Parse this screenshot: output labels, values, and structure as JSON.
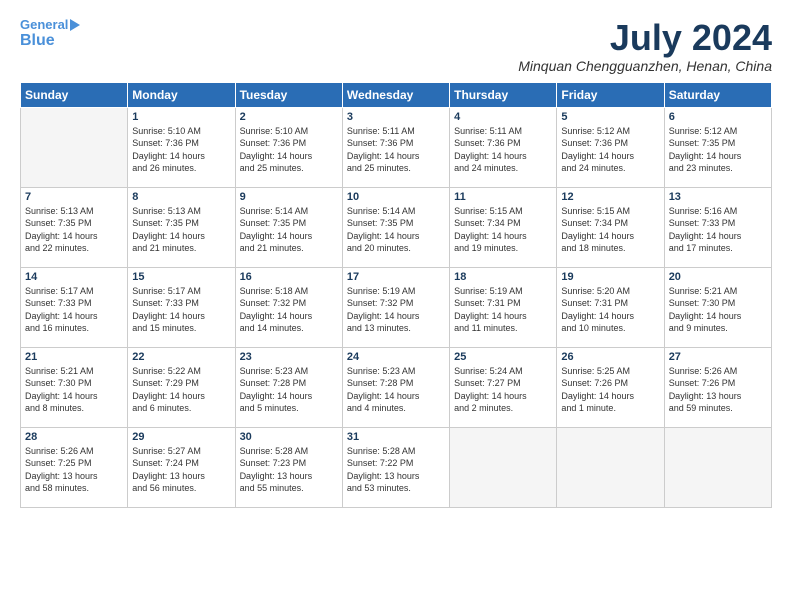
{
  "header": {
    "logo_line1": "General",
    "logo_line2": "Blue",
    "month_title": "July 2024",
    "location": "Minquan Chengguanzhen, Henan, China"
  },
  "weekdays": [
    "Sunday",
    "Monday",
    "Tuesday",
    "Wednesday",
    "Thursday",
    "Friday",
    "Saturday"
  ],
  "weeks": [
    [
      {
        "day": "",
        "info": ""
      },
      {
        "day": "1",
        "info": "Sunrise: 5:10 AM\nSunset: 7:36 PM\nDaylight: 14 hours\nand 26 minutes."
      },
      {
        "day": "2",
        "info": "Sunrise: 5:10 AM\nSunset: 7:36 PM\nDaylight: 14 hours\nand 25 minutes."
      },
      {
        "day": "3",
        "info": "Sunrise: 5:11 AM\nSunset: 7:36 PM\nDaylight: 14 hours\nand 25 minutes."
      },
      {
        "day": "4",
        "info": "Sunrise: 5:11 AM\nSunset: 7:36 PM\nDaylight: 14 hours\nand 24 minutes."
      },
      {
        "day": "5",
        "info": "Sunrise: 5:12 AM\nSunset: 7:36 PM\nDaylight: 14 hours\nand 24 minutes."
      },
      {
        "day": "6",
        "info": "Sunrise: 5:12 AM\nSunset: 7:35 PM\nDaylight: 14 hours\nand 23 minutes."
      }
    ],
    [
      {
        "day": "7",
        "info": "Sunrise: 5:13 AM\nSunset: 7:35 PM\nDaylight: 14 hours\nand 22 minutes."
      },
      {
        "day": "8",
        "info": "Sunrise: 5:13 AM\nSunset: 7:35 PM\nDaylight: 14 hours\nand 21 minutes."
      },
      {
        "day": "9",
        "info": "Sunrise: 5:14 AM\nSunset: 7:35 PM\nDaylight: 14 hours\nand 21 minutes."
      },
      {
        "day": "10",
        "info": "Sunrise: 5:14 AM\nSunset: 7:35 PM\nDaylight: 14 hours\nand 20 minutes."
      },
      {
        "day": "11",
        "info": "Sunrise: 5:15 AM\nSunset: 7:34 PM\nDaylight: 14 hours\nand 19 minutes."
      },
      {
        "day": "12",
        "info": "Sunrise: 5:15 AM\nSunset: 7:34 PM\nDaylight: 14 hours\nand 18 minutes."
      },
      {
        "day": "13",
        "info": "Sunrise: 5:16 AM\nSunset: 7:33 PM\nDaylight: 14 hours\nand 17 minutes."
      }
    ],
    [
      {
        "day": "14",
        "info": "Sunrise: 5:17 AM\nSunset: 7:33 PM\nDaylight: 14 hours\nand 16 minutes."
      },
      {
        "day": "15",
        "info": "Sunrise: 5:17 AM\nSunset: 7:33 PM\nDaylight: 14 hours\nand 15 minutes."
      },
      {
        "day": "16",
        "info": "Sunrise: 5:18 AM\nSunset: 7:32 PM\nDaylight: 14 hours\nand 14 minutes."
      },
      {
        "day": "17",
        "info": "Sunrise: 5:19 AM\nSunset: 7:32 PM\nDaylight: 14 hours\nand 13 minutes."
      },
      {
        "day": "18",
        "info": "Sunrise: 5:19 AM\nSunset: 7:31 PM\nDaylight: 14 hours\nand 11 minutes."
      },
      {
        "day": "19",
        "info": "Sunrise: 5:20 AM\nSunset: 7:31 PM\nDaylight: 14 hours\nand 10 minutes."
      },
      {
        "day": "20",
        "info": "Sunrise: 5:21 AM\nSunset: 7:30 PM\nDaylight: 14 hours\nand 9 minutes."
      }
    ],
    [
      {
        "day": "21",
        "info": "Sunrise: 5:21 AM\nSunset: 7:30 PM\nDaylight: 14 hours\nand 8 minutes."
      },
      {
        "day": "22",
        "info": "Sunrise: 5:22 AM\nSunset: 7:29 PM\nDaylight: 14 hours\nand 6 minutes."
      },
      {
        "day": "23",
        "info": "Sunrise: 5:23 AM\nSunset: 7:28 PM\nDaylight: 14 hours\nand 5 minutes."
      },
      {
        "day": "24",
        "info": "Sunrise: 5:23 AM\nSunset: 7:28 PM\nDaylight: 14 hours\nand 4 minutes."
      },
      {
        "day": "25",
        "info": "Sunrise: 5:24 AM\nSunset: 7:27 PM\nDaylight: 14 hours\nand 2 minutes."
      },
      {
        "day": "26",
        "info": "Sunrise: 5:25 AM\nSunset: 7:26 PM\nDaylight: 14 hours\nand 1 minute."
      },
      {
        "day": "27",
        "info": "Sunrise: 5:26 AM\nSunset: 7:26 PM\nDaylight: 13 hours\nand 59 minutes."
      }
    ],
    [
      {
        "day": "28",
        "info": "Sunrise: 5:26 AM\nSunset: 7:25 PM\nDaylight: 13 hours\nand 58 minutes."
      },
      {
        "day": "29",
        "info": "Sunrise: 5:27 AM\nSunset: 7:24 PM\nDaylight: 13 hours\nand 56 minutes."
      },
      {
        "day": "30",
        "info": "Sunrise: 5:28 AM\nSunset: 7:23 PM\nDaylight: 13 hours\nand 55 minutes."
      },
      {
        "day": "31",
        "info": "Sunrise: 5:28 AM\nSunset: 7:22 PM\nDaylight: 13 hours\nand 53 minutes."
      },
      {
        "day": "",
        "info": ""
      },
      {
        "day": "",
        "info": ""
      },
      {
        "day": "",
        "info": ""
      }
    ]
  ]
}
